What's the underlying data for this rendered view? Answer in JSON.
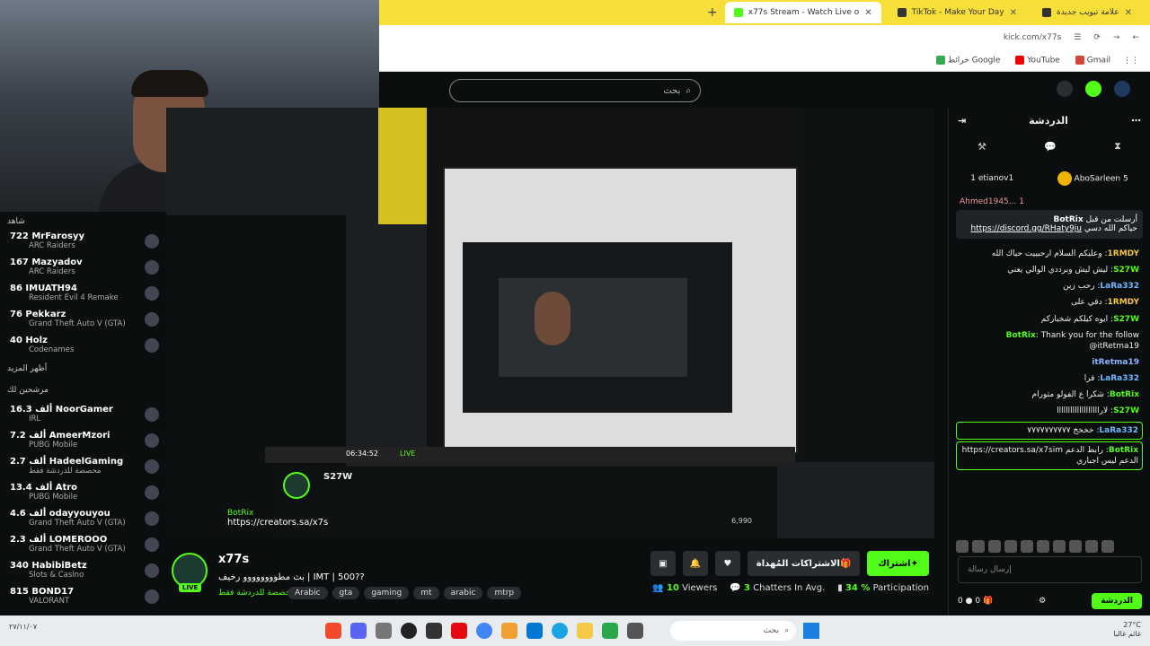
{
  "browser": {
    "tabs": [
      {
        "label": "علامة تبويب جديدة"
      },
      {
        "label": "TikTok - Make Your Day"
      },
      {
        "label": "x77s Stream - Watch Live o"
      }
    ],
    "new_tab": "+",
    "url": "kick.com/x77s",
    "bookmarks": [
      "خرائط Google",
      "YouTube",
      "Gmail"
    ]
  },
  "site": {
    "search_placeholder": "بحث"
  },
  "sidebar": {
    "section_top": "شاهد",
    "following": [
      {
        "viewers": "722",
        "name": "MrFarosyy",
        "game": "ARC Raiders"
      },
      {
        "viewers": "167",
        "name": "Mazyadov",
        "game": "ARC Raiders"
      },
      {
        "viewers": "86",
        "name": "IMUATH94",
        "game": "Resident Evil 4 Remake"
      },
      {
        "viewers": "76",
        "name": "Pekkarz",
        "game": "Grand Theft Auto V (GTA)"
      },
      {
        "viewers": "40",
        "name": "Holz",
        "game": "Codenames"
      }
    ],
    "show_more": "أظهر المزيد",
    "recommended_heading": "مرشحين لك",
    "recommended": [
      {
        "viewers": "16.3 ألف",
        "name": "NoorGamer",
        "game": "IRL"
      },
      {
        "viewers": "7.2 ألف",
        "name": "AmeerMzori",
        "game": "PUBG Mobile"
      },
      {
        "viewers": "2.7 ألف",
        "name": "HadeelGaming",
        "game": "مخصصة للدردشة فقط"
      },
      {
        "viewers": "13.4 ألف",
        "name": "Atro",
        "game": "PUBG Mobile"
      },
      {
        "viewers": "4.6 ألف",
        "name": "odayyouyou",
        "game": "Grand Theft Auto V (GTA)"
      },
      {
        "viewers": "2.3 ألف",
        "name": "LOMEROOO",
        "game": "Grand Theft Auto V (GTA)"
      },
      {
        "viewers": "340",
        "name": "HabibiBetz",
        "game": "Slots & Casino"
      },
      {
        "viewers": "815",
        "name": "BOND17",
        "game": "VALORANT"
      }
    ]
  },
  "stream": {
    "overlay_streamer": "S27W",
    "overlay_promo_user": "BotRix",
    "overlay_promo_link": "https://creators.sa/x7s",
    "player_time": "06:34:52",
    "player_live": "LIVE",
    "inner_viewers": "6,990"
  },
  "channel": {
    "name": "x77s",
    "live_label": "LIVE",
    "title": "بث مطوووووووو رخيف | IMT | 500??",
    "category": "مخصصة للدردشة فقط",
    "tags": [
      "Arabic",
      "gta",
      "gaming",
      "mt",
      "arabic",
      "mtrp"
    ],
    "gift_label": "الاشتراكات المُهداة",
    "follow_label": "اشتراك",
    "stats": {
      "viewers_num": "10",
      "viewers_label": "Viewers",
      "chatters_num": "3",
      "chatters_label": "Chatters In Avg.",
      "participation_num": "34 %",
      "participation_label": "Participation"
    }
  },
  "chat": {
    "title": "الدردشة",
    "leaderboard": [
      {
        "name": "AboSarleen",
        "count": "5"
      },
      {
        "name": "etianov1",
        "count": "1"
      },
      {
        "name": "Ahmed1945...",
        "count": "1"
      }
    ],
    "pinned_user": "BotRix",
    "pinned_prefix": "أرسلت من قبل",
    "pinned_text": "حياكم الله دسي",
    "pinned_link": "https://discord.gg/RHaty9ju",
    "messages": [
      {
        "user": "1RMDY",
        "text": "وعليكم السلام ارحبييت حياك الله"
      },
      {
        "user": "S27W",
        "text": "ليش ليش وبرددي الوالي يعني"
      },
      {
        "user": "LaRa332",
        "text": "رحب زين"
      },
      {
        "user": "1RMDY",
        "text": "دقي على"
      },
      {
        "user": "S27W",
        "text": "ايوه كيلكم شخباركم"
      },
      {
        "user": "BotRix",
        "text": "Thank you for the follow @itRetma19"
      },
      {
        "user": "itRetma19",
        "text": ""
      },
      {
        "user": "LaRa332",
        "text": "قرا"
      },
      {
        "user": "BotRix",
        "text": "شكرا ع الفولو متورام"
      },
      {
        "user": "S27W",
        "text": "لارااااااااااااااااااا"
      },
      {
        "user": "LaRa332",
        "text": "خخخخ ٧٧٧٧٧٧٧٧٧٧"
      },
      {
        "user": "BotRix",
        "text": "رابط الدعم https://creators.sa/x7sim الدعم ليس اجباري"
      }
    ],
    "input_placeholder": "إرسال رسالة",
    "send_label": "الدردشة",
    "footer_count_a": "0",
    "footer_count_b": "0"
  },
  "taskbar": {
    "search_placeholder": "بحث",
    "temperature": "27°C",
    "weather": "غائم غالبا",
    "date": "٢٧/١١/٠٧"
  },
  "colors": {
    "accent": "#53fc18",
    "tabbar": "#f7df3a",
    "page_bg": "#0b0e0f"
  }
}
